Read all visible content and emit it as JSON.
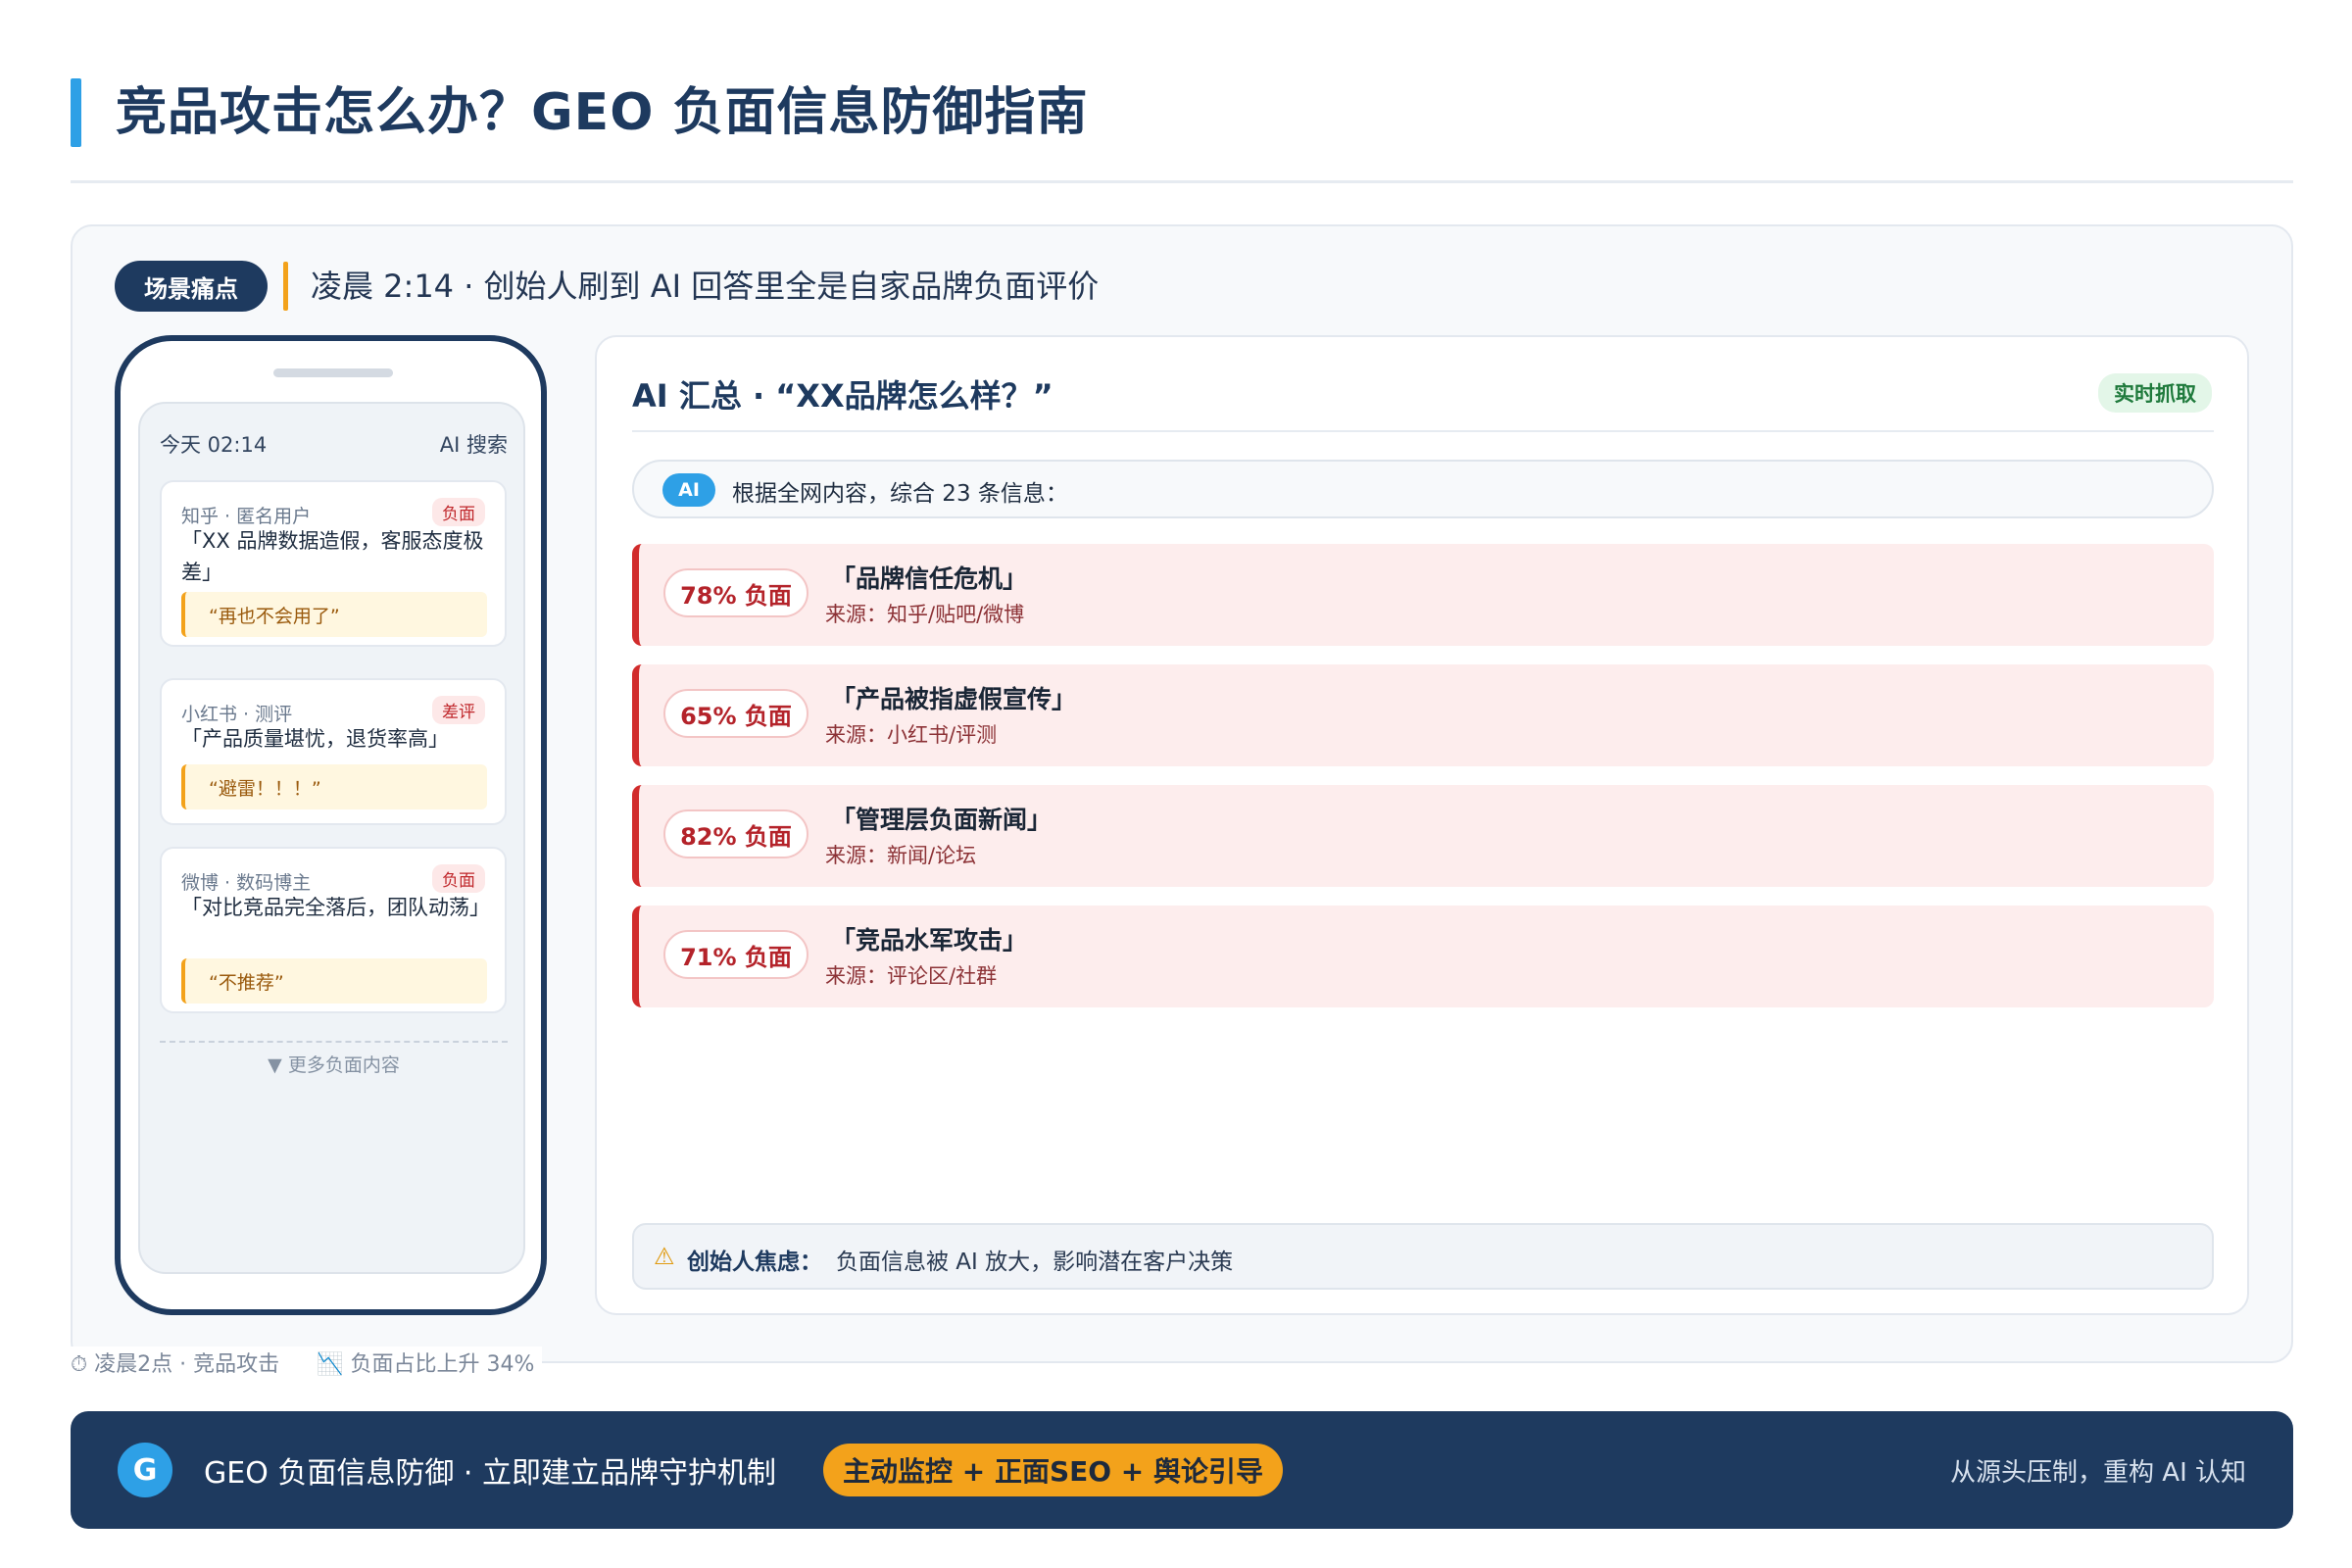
{
  "page": {
    "title": "竞品攻击怎么办？GEO 负面信息防御指南"
  },
  "scene": {
    "badge": "场景痛点",
    "text": "凌晨 2:14 · 创始人刷到 AI 回答里全是自家品牌负面评价"
  },
  "phone": {
    "time": "今天 02:14",
    "app": "AI 搜索",
    "posts": [
      {
        "meta": "知乎 · 匿名用户",
        "tag": "负面",
        "body": "「XX 品牌数据造假，客服态度极差」",
        "quote": "“再也不会用了”"
      },
      {
        "meta": "小红书 · 测评",
        "tag": "差评",
        "body": "「产品质量堪忧，退货率高」",
        "quote": "“避雷！！！”"
      },
      {
        "meta": "微博 · 数码博主",
        "tag": "负面",
        "body": "「对比竞品完全落后，团队动荡」",
        "quote": "“不推荐”"
      }
    ],
    "more": "▼ 更多负面内容"
  },
  "ai_panel": {
    "title": "AI 汇总 · “XX品牌怎么样？”",
    "live_badge": "实时抓取",
    "chip": "AI",
    "summary": "根据全网内容，综合 23 条信息：",
    "items": [
      {
        "percent": "78% 负面",
        "title": "「品牌信任危机」",
        "source": "来源：知乎/贴吧/微博"
      },
      {
        "percent": "65% 负面",
        "title": "「产品被指虚假宣传」",
        "source": "来源：小红书/评测"
      },
      {
        "percent": "82% 负面",
        "title": "「管理层负面新闻」",
        "source": "来源：新闻/论坛"
      },
      {
        "percent": "71% 负面",
        "title": "「竞品水军攻击」",
        "source": "来源：评论区/社群"
      }
    ],
    "worry_icon": "warning-icon",
    "worry_label": "创始人焦虑：",
    "worry_text": "负面信息被 AI 放大，影响潜在客户决策"
  },
  "footer_notes": {
    "time_note": "⏱ 凌晨2点 · 竞品攻击",
    "trend_note": "📉 负面占比上升 34%"
  },
  "banner": {
    "logo": "G",
    "text": "GEO 负面信息防御 · 立即建立品牌守护机制",
    "pill": "主动监控 + 正面SEO + 舆论引导",
    "right": "从源头压制，重构 AI 认知"
  },
  "colors": {
    "navy": "#1e3a5f",
    "accent_blue": "#2ea0e6",
    "accent_orange": "#f3a21b",
    "negative_red": "#d12c2c",
    "negative_bg": "#fdeded",
    "live_green": "#1f7a3c"
  }
}
